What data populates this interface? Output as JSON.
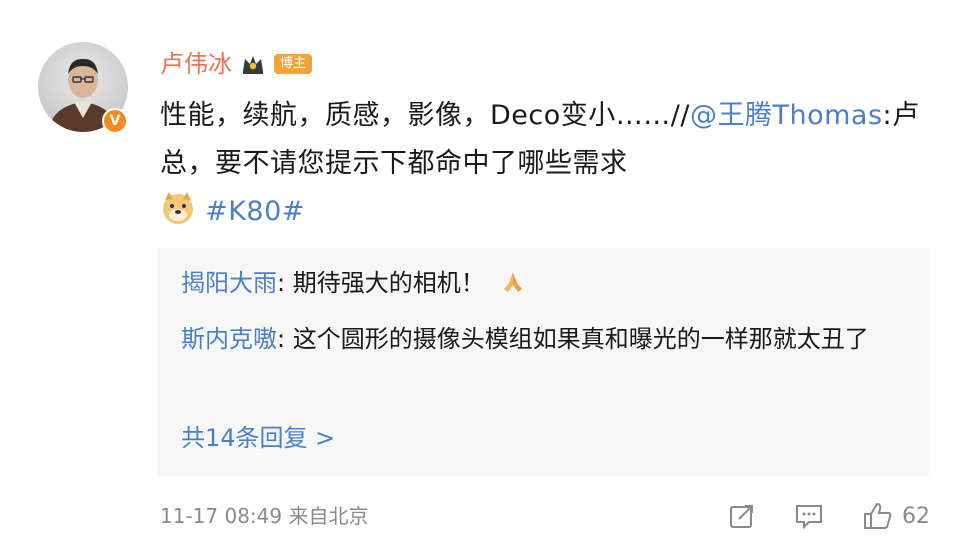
{
  "post": {
    "author": "卢伟冰",
    "author_tag": "博主",
    "crown_icon": "crown-icon",
    "verified_badge": "V",
    "text_main": "性能，续航，质感，影像，Deco变小……//",
    "mention": "@王腾Thomas",
    "text_after_mention": ":卢总，要不请您提示下都命中了哪些需求",
    "emoji": "doge-emoji",
    "topic": "#K80#"
  },
  "replies": [
    {
      "nick": "揭阳大雨",
      "text": ": 期待强大的相机！",
      "emoji": "praying-hands-emoji"
    },
    {
      "nick": "斯内克嗷",
      "text": ": 这个圆形的摄像头模组如果真和曝光的一样那就太丑了"
    }
  ],
  "more_replies": "共14条回复 >",
  "footer": {
    "meta": "11-17 08:49 来自北京",
    "like_count": "62"
  },
  "colors": {
    "link": "#4a80c9",
    "author": "#eb7350",
    "tag": "#f2a33a",
    "muted": "#8a8a8a"
  }
}
